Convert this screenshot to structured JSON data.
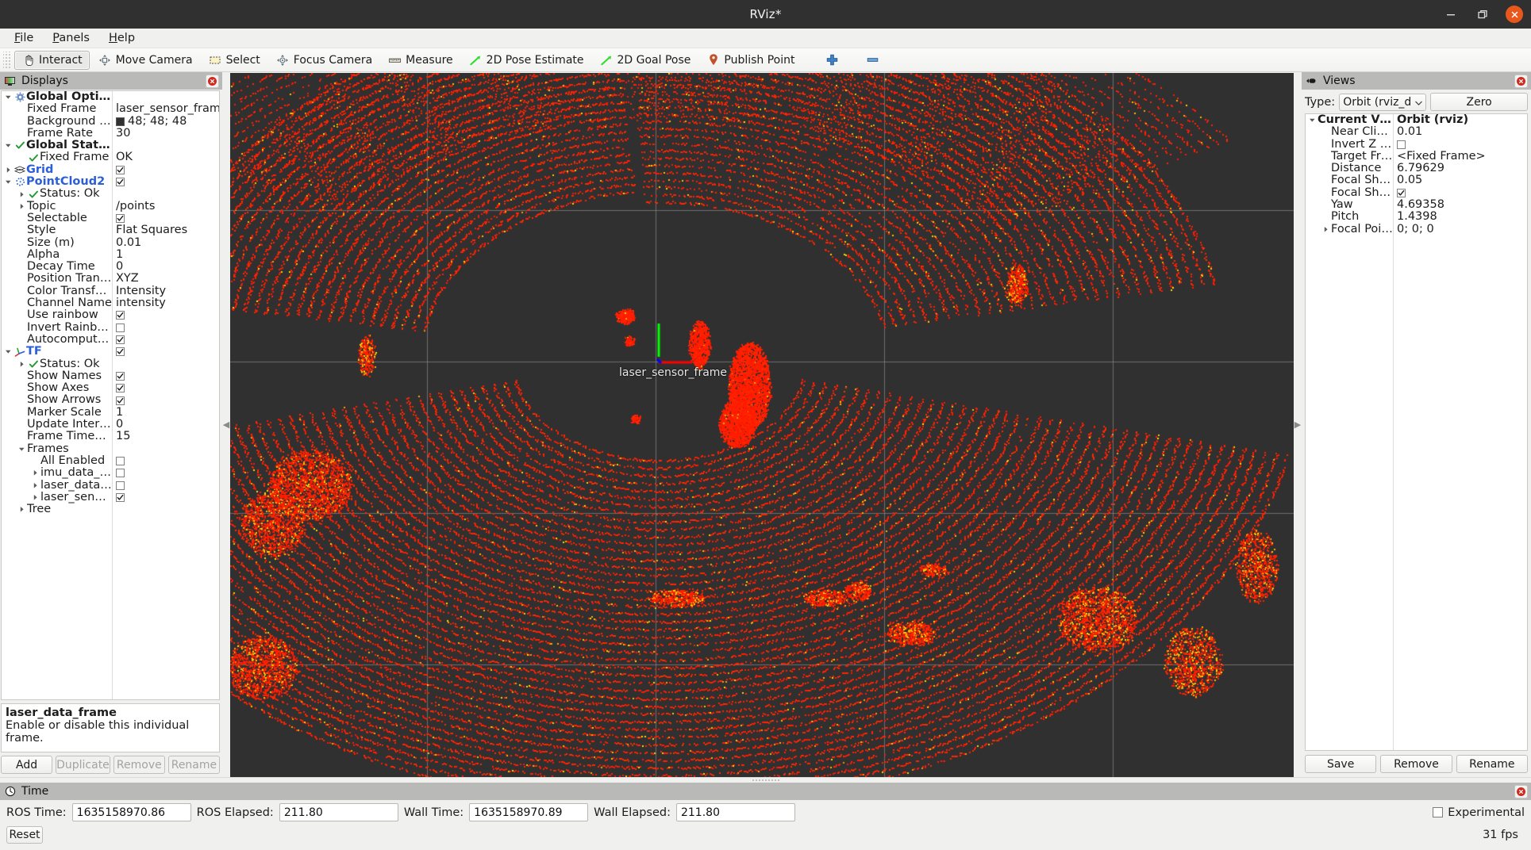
{
  "window": {
    "title": "RViz*",
    "minimize_icon": "minimize-icon",
    "maximize_icon": "maximize-icon",
    "close_icon": "close-icon"
  },
  "menubar": {
    "items": [
      {
        "label": "File",
        "mnemonic": "F"
      },
      {
        "label": "Panels",
        "mnemonic": "P"
      },
      {
        "label": "Help",
        "mnemonic": "H"
      }
    ]
  },
  "toolbar": {
    "tools": [
      {
        "label": "Interact",
        "icon": "hand-cursor-icon",
        "active": true
      },
      {
        "label": "Move Camera",
        "icon": "move-camera-icon",
        "active": false
      },
      {
        "label": "Select",
        "icon": "select-rectangle-icon",
        "active": false
      },
      {
        "label": "Focus Camera",
        "icon": "focus-camera-icon",
        "active": false
      },
      {
        "label": "Measure",
        "icon": "ruler-icon",
        "active": false
      },
      {
        "label": "2D Pose Estimate",
        "icon": "green-arrow-icon",
        "active": false
      },
      {
        "label": "2D Goal Pose",
        "icon": "green-arrow-icon",
        "active": false
      },
      {
        "label": "Publish Point",
        "icon": "map-pin-icon",
        "active": false
      }
    ],
    "extra": [
      {
        "label": "",
        "icon": "plus-icon"
      },
      {
        "label": "",
        "icon": "minus-icon"
      }
    ]
  },
  "displays_panel": {
    "title": "Displays",
    "title_icon": "displays-monitor-icon",
    "close_icon": "close-icon",
    "tree": [
      {
        "indent": 0,
        "arrow": "down",
        "icon": "gear-icon",
        "label": "Global Options",
        "style": "bold",
        "value": "",
        "value_type": "none"
      },
      {
        "indent": 1,
        "arrow": "none",
        "icon": "none",
        "label": "Fixed Frame",
        "value": "laser_sensor_frame",
        "value_type": "text"
      },
      {
        "indent": 1,
        "arrow": "none",
        "icon": "none",
        "label": "Background Color",
        "value": "48; 48; 48",
        "value_type": "color",
        "color": "#303030"
      },
      {
        "indent": 1,
        "arrow": "none",
        "icon": "none",
        "label": "Frame Rate",
        "value": "30",
        "value_type": "text"
      },
      {
        "indent": 0,
        "arrow": "down",
        "icon": "check-icon",
        "label": "Global Status: Ok",
        "style": "bold",
        "value": "",
        "value_type": "none"
      },
      {
        "indent": 1,
        "arrow": "none",
        "icon": "check-icon",
        "label": "Fixed Frame",
        "value": "OK",
        "value_type": "text"
      },
      {
        "indent": 0,
        "arrow": "right",
        "icon": "grid-icon",
        "label": "Grid",
        "style": "bluebold",
        "value": "checked",
        "value_type": "checkbox"
      },
      {
        "indent": 0,
        "arrow": "down",
        "icon": "pointcloud-icon",
        "label": "PointCloud2",
        "style": "bluebold",
        "value": "checked",
        "value_type": "checkbox"
      },
      {
        "indent": 1,
        "arrow": "right",
        "icon": "check-icon",
        "label": "Status: Ok",
        "value": "",
        "value_type": "none"
      },
      {
        "indent": 1,
        "arrow": "right",
        "icon": "none",
        "label": "Topic",
        "value": "/points",
        "value_type": "text"
      },
      {
        "indent": 1,
        "arrow": "none",
        "icon": "none",
        "label": "Selectable",
        "value": "checked",
        "value_type": "checkbox"
      },
      {
        "indent": 1,
        "arrow": "none",
        "icon": "none",
        "label": "Style",
        "value": "Flat Squares",
        "value_type": "text"
      },
      {
        "indent": 1,
        "arrow": "none",
        "icon": "none",
        "label": "Size (m)",
        "value": "0.01",
        "value_type": "text"
      },
      {
        "indent": 1,
        "arrow": "none",
        "icon": "none",
        "label": "Alpha",
        "value": "1",
        "value_type": "text"
      },
      {
        "indent": 1,
        "arrow": "none",
        "icon": "none",
        "label": "Decay Time",
        "value": "0",
        "value_type": "text"
      },
      {
        "indent": 1,
        "arrow": "none",
        "icon": "none",
        "label": "Position Transf...",
        "value": "XYZ",
        "value_type": "text"
      },
      {
        "indent": 1,
        "arrow": "none",
        "icon": "none",
        "label": "Color Transfor...",
        "value": "Intensity",
        "value_type": "text"
      },
      {
        "indent": 1,
        "arrow": "none",
        "icon": "none",
        "label": "Channel Name",
        "value": "intensity",
        "value_type": "text"
      },
      {
        "indent": 1,
        "arrow": "none",
        "icon": "none",
        "label": "Use rainbow",
        "value": "checked",
        "value_type": "checkbox"
      },
      {
        "indent": 1,
        "arrow": "none",
        "icon": "none",
        "label": "Invert Rainbow",
        "value": "unchecked",
        "value_type": "checkbox"
      },
      {
        "indent": 1,
        "arrow": "none",
        "icon": "none",
        "label": "Autocompute I...",
        "value": "checked",
        "value_type": "checkbox"
      },
      {
        "indent": 0,
        "arrow": "down",
        "icon": "tf-axes-icon",
        "label": "TF",
        "style": "bluebold",
        "value": "checked",
        "value_type": "checkbox"
      },
      {
        "indent": 1,
        "arrow": "right",
        "icon": "check-icon",
        "label": "Status: Ok",
        "value": "",
        "value_type": "none"
      },
      {
        "indent": 1,
        "arrow": "none",
        "icon": "none",
        "label": "Show Names",
        "value": "checked",
        "value_type": "checkbox"
      },
      {
        "indent": 1,
        "arrow": "none",
        "icon": "none",
        "label": "Show Axes",
        "value": "checked",
        "value_type": "checkbox"
      },
      {
        "indent": 1,
        "arrow": "none",
        "icon": "none",
        "label": "Show Arrows",
        "value": "checked",
        "value_type": "checkbox"
      },
      {
        "indent": 1,
        "arrow": "none",
        "icon": "none",
        "label": "Marker Scale",
        "value": "1",
        "value_type": "text"
      },
      {
        "indent": 1,
        "arrow": "none",
        "icon": "none",
        "label": "Update Interval",
        "value": "0",
        "value_type": "text"
      },
      {
        "indent": 1,
        "arrow": "none",
        "icon": "none",
        "label": "Frame Timeout",
        "value": "15",
        "value_type": "text"
      },
      {
        "indent": 1,
        "arrow": "down",
        "icon": "none",
        "label": "Frames",
        "value": "",
        "value_type": "none"
      },
      {
        "indent": 2,
        "arrow": "none",
        "icon": "none",
        "label": "All Enabled",
        "value": "unchecked",
        "value_type": "checkbox"
      },
      {
        "indent": 2,
        "arrow": "right",
        "icon": "none",
        "label": "imu_data_fr...",
        "value": "unchecked",
        "value_type": "checkbox"
      },
      {
        "indent": 2,
        "arrow": "right",
        "icon": "none",
        "label": "laser_data_f...",
        "value": "unchecked",
        "value_type": "checkbox"
      },
      {
        "indent": 2,
        "arrow": "right",
        "icon": "none",
        "label": "laser_sensor...",
        "value": "checked",
        "value_type": "checkbox"
      },
      {
        "indent": 1,
        "arrow": "right",
        "icon": "none",
        "label": "Tree",
        "value": "",
        "value_type": "none"
      }
    ],
    "help": {
      "heading": "laser_data_frame",
      "body": "Enable or disable this individual frame."
    },
    "buttons": [
      {
        "label": "Add",
        "enabled": true
      },
      {
        "label": "Duplicate",
        "enabled": false
      },
      {
        "label": "Remove",
        "enabled": false
      },
      {
        "label": "Rename",
        "enabled": false
      }
    ]
  },
  "viewport": {
    "frame_label": "laser_sensor_frame",
    "background_color": "#303030",
    "grid_color": "#9a9a9a",
    "axis_x_color": "#ff0000",
    "axis_y_color": "#00ff00",
    "axis_z_color": "#0000ff",
    "point_color_low": "#ff1400",
    "point_color_high": "#ffe000"
  },
  "views_panel": {
    "title": "Views",
    "title_icon": "views-camera-icon",
    "close_icon": "close-icon",
    "type_label": "Type:",
    "type_value": "Orbit (rviz_defau",
    "zero_label": "Zero",
    "tree": [
      {
        "indent": 0,
        "arrow": "down",
        "label": "Current View",
        "style": "bold",
        "value": "Orbit (rviz)",
        "value_style": "bold",
        "value_type": "text"
      },
      {
        "indent": 1,
        "arrow": "none",
        "label": "Near Clip ...",
        "value": "0.01",
        "value_type": "text"
      },
      {
        "indent": 1,
        "arrow": "none",
        "label": "Invert Z Axis",
        "value": "unchecked",
        "value_type": "checkbox"
      },
      {
        "indent": 1,
        "arrow": "none",
        "label": "Target Fra...",
        "value": "<Fixed Frame>",
        "value_type": "text"
      },
      {
        "indent": 1,
        "arrow": "none",
        "label": "Distance",
        "value": "6.79629",
        "value_type": "text"
      },
      {
        "indent": 1,
        "arrow": "none",
        "label": "Focal Shap...",
        "value": "0.05",
        "value_type": "text"
      },
      {
        "indent": 1,
        "arrow": "none",
        "label": "Focal Shap...",
        "value": "checked",
        "value_type": "checkbox"
      },
      {
        "indent": 1,
        "arrow": "none",
        "label": "Yaw",
        "value": "4.69358",
        "value_type": "text"
      },
      {
        "indent": 1,
        "arrow": "none",
        "label": "Pitch",
        "value": "1.4398",
        "value_type": "text"
      },
      {
        "indent": 1,
        "arrow": "right",
        "label": "Focal Point",
        "value": "0; 0; 0",
        "value_type": "text"
      }
    ],
    "buttons": [
      {
        "label": "Save"
      },
      {
        "label": "Remove"
      },
      {
        "label": "Rename"
      }
    ]
  },
  "time_panel": {
    "title": "Time",
    "title_icon": "clock-icon",
    "close_icon": "close-icon",
    "fields": [
      {
        "label": "ROS Time:",
        "value": "1635158970.86"
      },
      {
        "label": "ROS Elapsed:",
        "value": "211.80"
      },
      {
        "label": "Wall Time:",
        "value": "1635158970.89"
      },
      {
        "label": "Wall Elapsed:",
        "value": "211.80"
      }
    ],
    "experimental_label": "Experimental",
    "experimental_checked": false,
    "reset_label": "Reset",
    "fps": "31 fps"
  }
}
